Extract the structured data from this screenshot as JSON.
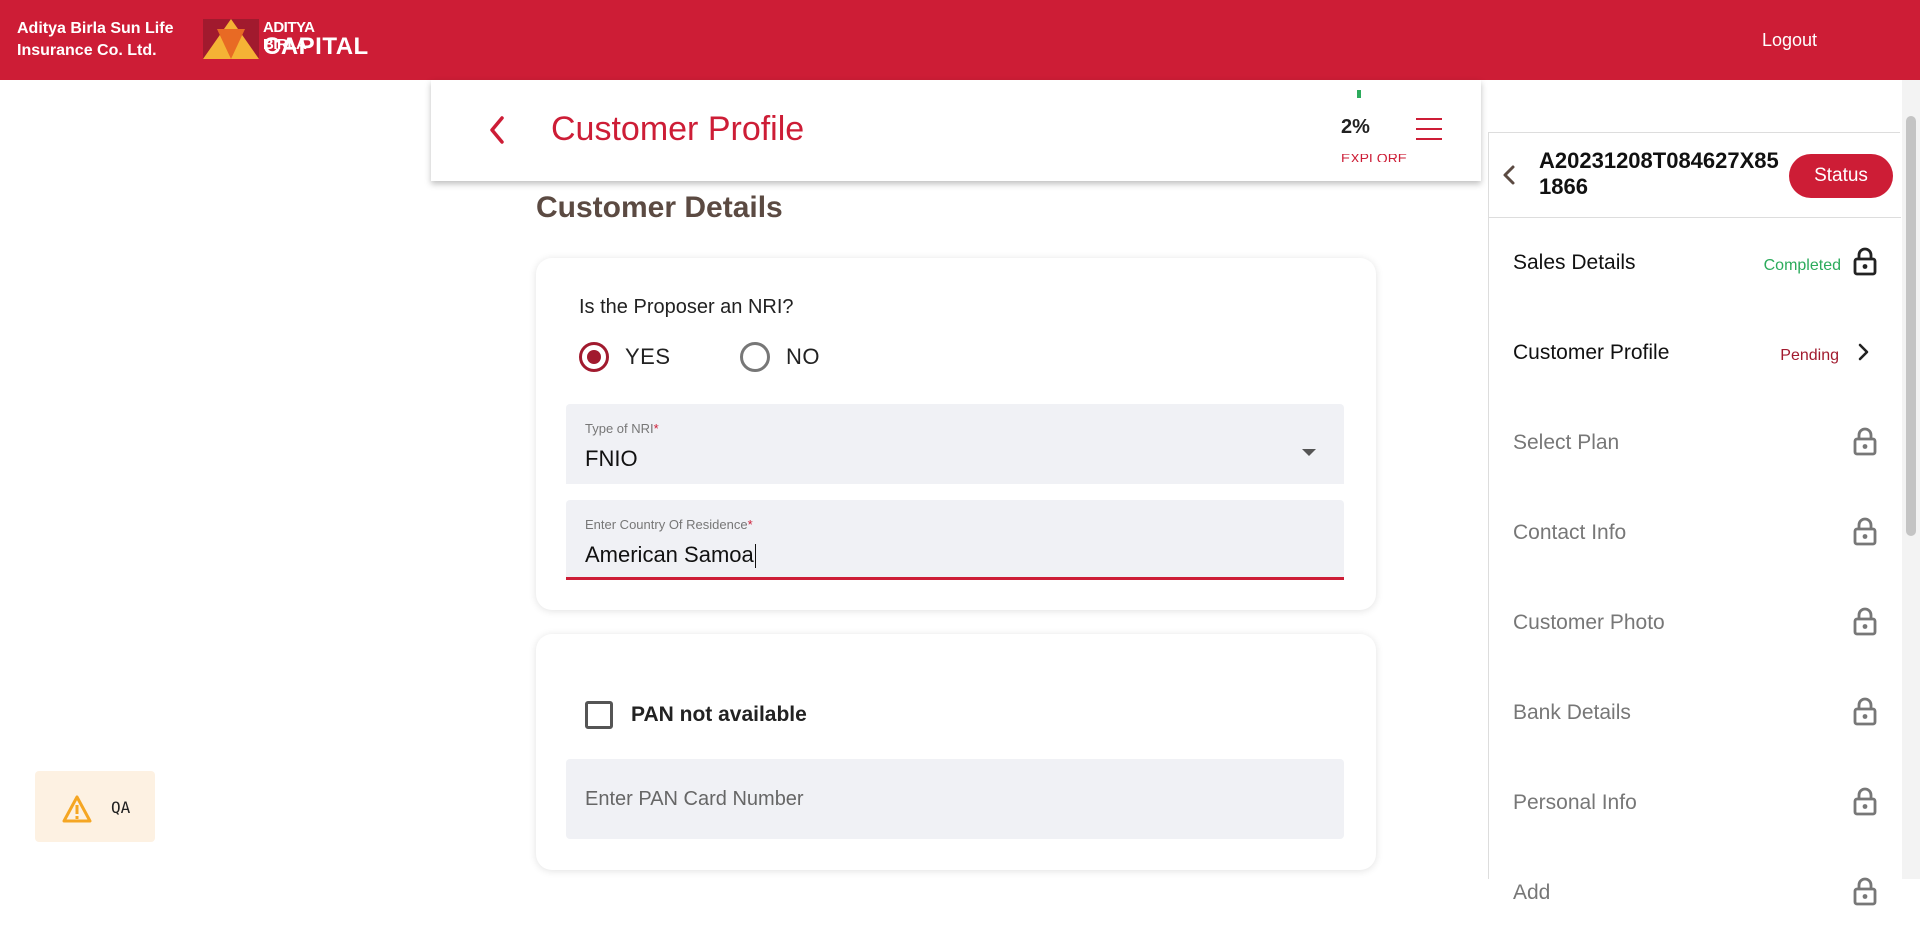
{
  "topbar": {
    "brand_line1": "Aditya Birla Sun Life",
    "brand_line2": "Insurance Co. Ltd.",
    "logo_line1": "ADITYA BIRLA",
    "logo_line2": "CAPITAL",
    "logout_label": "Logout",
    "color": "#cd1d36"
  },
  "header": {
    "peek_text": "EXPLORE",
    "title": "Customer Profile",
    "progress_label": "2%",
    "progress": 0.02
  },
  "section_title": "Customer Details",
  "nri": {
    "question": "Is the Proposer an NRI?",
    "yes_label": "YES",
    "no_label": "NO",
    "selected": "YES",
    "type_label": "Type of NRI",
    "type_value": "FNIO",
    "country_label": "Enter Country Of Residence",
    "country_value": "American Samoa",
    "required_mark": "*"
  },
  "pan": {
    "checkbox_label": "PAN not available",
    "checked": false,
    "placeholder": "Enter PAN Card Number"
  },
  "qa_badge": {
    "label": "QA",
    "icon": "warning-icon"
  },
  "sidebar": {
    "app_id": "A20231208T084627X851866",
    "status_button": "Status",
    "items": [
      {
        "label": "Sales Details",
        "status": "Completed",
        "status_color": "#2cab5c",
        "icon": "lock-icon"
      },
      {
        "label": "Customer Profile",
        "status": "Pending",
        "status_color": "#a11a2e",
        "icon": "chevron-right-icon"
      },
      {
        "label": "Select Plan",
        "status": "",
        "icon": "lock-icon"
      },
      {
        "label": "Contact Info",
        "status": "",
        "icon": "lock-icon"
      },
      {
        "label": "Customer Photo",
        "status": "",
        "icon": "lock-icon"
      },
      {
        "label": "Bank Details",
        "status": "",
        "icon": "lock-icon"
      },
      {
        "label": "Personal Info",
        "status": "",
        "icon": "lock-icon"
      },
      {
        "label": "Add",
        "status": "",
        "icon": "lock-icon"
      }
    ]
  }
}
